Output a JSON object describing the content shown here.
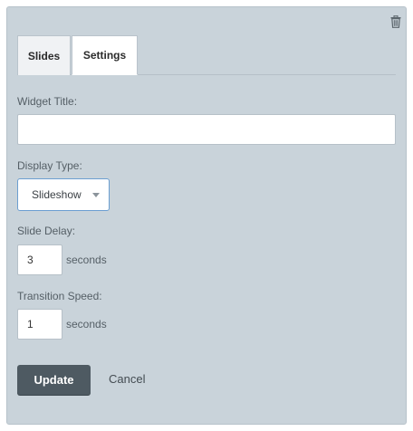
{
  "tabs": [
    {
      "label": "Slides"
    },
    {
      "label": "Settings"
    }
  ],
  "fields": {
    "widget_title": {
      "label": "Widget Title:",
      "value": ""
    },
    "display_type": {
      "label": "Display Type:",
      "value": "Slideshow"
    },
    "slide_delay": {
      "label": "Slide Delay:",
      "value": "3",
      "unit": "seconds"
    },
    "transition_speed": {
      "label": "Transition Speed:",
      "value": "1",
      "unit": "seconds"
    }
  },
  "actions": {
    "update_label": "Update",
    "cancel_label": "Cancel"
  },
  "icons": {
    "delete": "trash-icon",
    "dropdown": "caret-down-icon"
  },
  "colors": {
    "panel_bg": "#c9d3da",
    "primary_button": "#4e5a62",
    "select_border": "#6b9ed1"
  }
}
